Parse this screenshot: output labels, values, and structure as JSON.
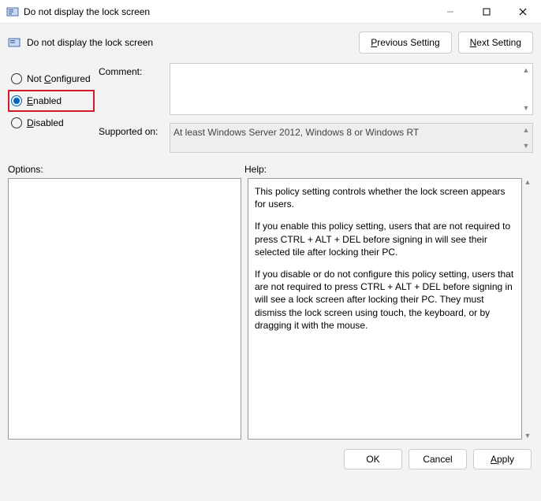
{
  "window": {
    "title": "Do not display the lock screen"
  },
  "header": {
    "policy_title": "Do not display the lock screen",
    "prev_btn": {
      "pre": "",
      "u": "P",
      "post": "revious Setting"
    },
    "next_btn": {
      "pre": "",
      "u": "N",
      "post": "ext Setting"
    }
  },
  "radios": {
    "not_configured": {
      "pre": "Not ",
      "u": "C",
      "post": "onfigured"
    },
    "enabled": {
      "pre": "",
      "u": "E",
      "post": "nabled"
    },
    "disabled": {
      "pre": "",
      "u": "D",
      "post": "isabled"
    },
    "selected": "enabled"
  },
  "fields": {
    "comment_label": "Comment:",
    "comment_value": "",
    "supported_label": "Supported on:",
    "supported_value": "At least Windows Server 2012, Windows 8 or Windows RT"
  },
  "lower": {
    "options_label": "Options:",
    "help_label": "Help:",
    "help_paragraphs": [
      "This policy setting controls whether the lock screen appears for users.",
      "If you enable this policy setting, users that are not required to press CTRL + ALT + DEL before signing in will see their selected tile after locking their PC.",
      "If you disable or do not configure this policy setting, users that are not required to press CTRL + ALT + DEL before signing in will see a lock screen after locking their PC. They must dismiss the lock screen using touch, the keyboard, or by dragging it with the mouse."
    ]
  },
  "footer": {
    "ok": "OK",
    "cancel": "Cancel",
    "apply": {
      "pre": "",
      "u": "A",
      "post": "pply"
    }
  }
}
